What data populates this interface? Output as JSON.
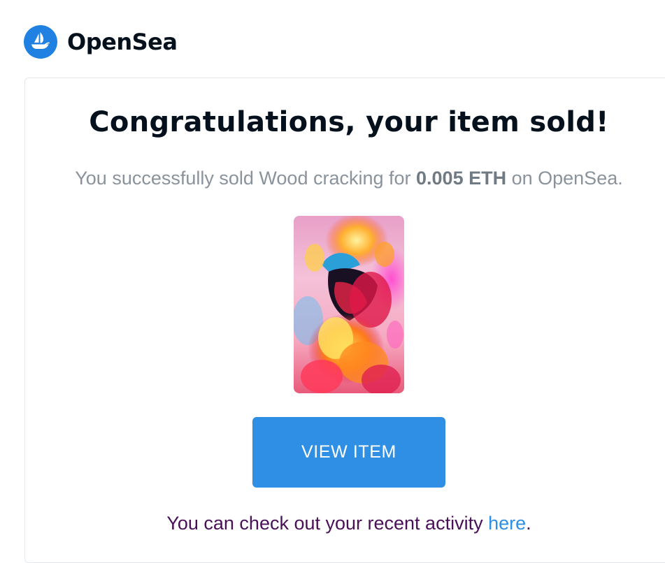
{
  "brand": {
    "name": "OpenSea",
    "logo_icon": "sailboat-icon",
    "logo_color": "#2081e2"
  },
  "email": {
    "headline": "Congratulations, your item sold!",
    "subtitle_prefix": "You successfully sold Wood cracking for ",
    "price": "0.005 ETH",
    "subtitle_suffix": " on OpenSea.",
    "item_image_icon": "fiery-abstract-artwork",
    "button_label": "VIEW ITEM",
    "button_color": "#2e8fe4",
    "footer_prefix": "You can check out your recent activity ",
    "footer_link": "here",
    "footer_suffix": "."
  }
}
